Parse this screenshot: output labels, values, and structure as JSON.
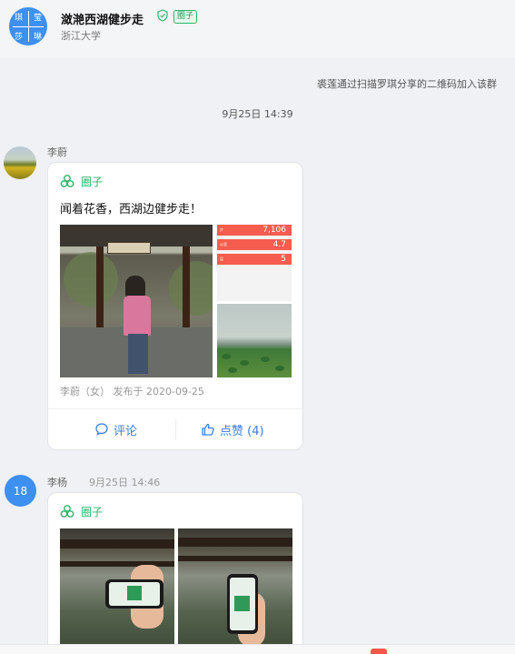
{
  "header": {
    "avatar_chars": [
      "琪",
      "莹",
      "莎",
      "琳"
    ],
    "title": "潋滟西湖健步走",
    "badge": "圈子",
    "subtitle": "浙江大学"
  },
  "system_message": "裘莲通过扫描罗琪分享的二维码加入该群",
  "timestamp": "9月25日 14:39",
  "messages": [
    {
      "sender": "李蔚",
      "card_label": "圈子",
      "post_text": "闻着花香，西湖边健步走！",
      "meta": "李蔚（女） 发布于 2020-09-25",
      "comment_label": "评论",
      "like_label": "点赞 (4)",
      "health_rows": [
        {
          "value": "7,106",
          "unit": "步"
        },
        {
          "value": "4.7",
          "unit": "公里"
        },
        {
          "value": "5",
          "unit": "层"
        }
      ]
    },
    {
      "sender": "李杨",
      "time": "9月25日 14:46",
      "avatar_text": "18",
      "card_label": "圈子"
    }
  ],
  "colors": {
    "accent_blue": "#3d8ff0",
    "accent_green": "#2bb56a",
    "background": "#eff1f4"
  },
  "icons": [
    "verified-shield-icon",
    "quan-circle-icon",
    "comment-icon",
    "thumbs-up-icon"
  ]
}
